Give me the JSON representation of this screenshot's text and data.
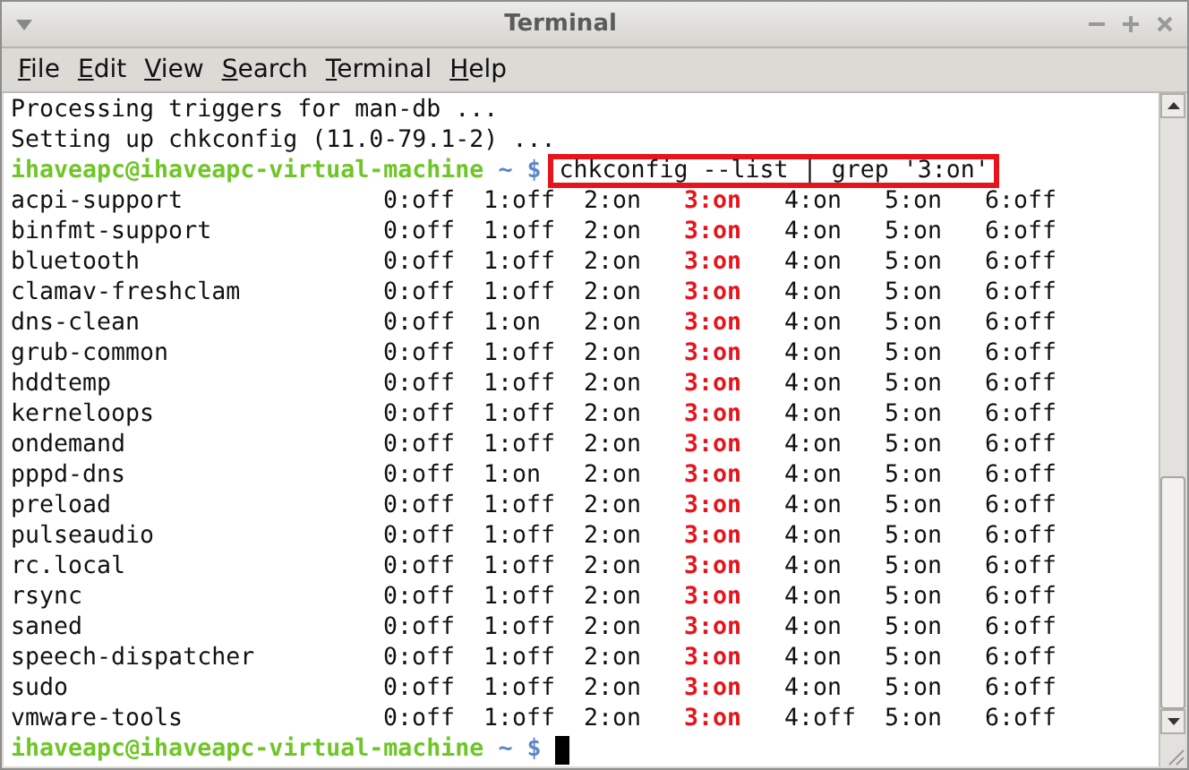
{
  "window": {
    "title": "Terminal"
  },
  "menu": [
    {
      "label": "File",
      "mnemonic_underlined": true
    },
    {
      "label": "Edit",
      "mnemonic_underlined": true
    },
    {
      "label": "View",
      "mnemonic_underlined": true
    },
    {
      "label": "Search",
      "mnemonic_underlined": true
    },
    {
      "label": "Terminal",
      "mnemonic_underlined": true
    },
    {
      "label": "Help",
      "mnemonic_underlined": true
    }
  ],
  "output_lines": [
    "Processing triggers for man-db ...",
    "Setting up chkconfig (11.0-79.1-2) ..."
  ],
  "prompt": {
    "user_host": "ihaveapc@ihaveapc-virtual-machine",
    "path": "~ $",
    "command": "chkconfig --list | grep '3:on'",
    "command_highlighted": true
  },
  "rows": [
    {
      "name": "acpi-support",
      "levels": [
        {
          "text": "0:off",
          "highlighted": false
        },
        {
          "text": "1:off",
          "highlighted": false
        },
        {
          "text": "2:on",
          "highlighted": false
        },
        {
          "text": "3:on",
          "highlighted": true
        },
        {
          "text": "4:on",
          "highlighted": false
        },
        {
          "text": "5:on",
          "highlighted": false
        },
        {
          "text": "6:off",
          "highlighted": false
        }
      ]
    },
    {
      "name": "binfmt-support",
      "levels": [
        {
          "text": "0:off",
          "highlighted": false
        },
        {
          "text": "1:off",
          "highlighted": false
        },
        {
          "text": "2:on",
          "highlighted": false
        },
        {
          "text": "3:on",
          "highlighted": true
        },
        {
          "text": "4:on",
          "highlighted": false
        },
        {
          "text": "5:on",
          "highlighted": false
        },
        {
          "text": "6:off",
          "highlighted": false
        }
      ]
    },
    {
      "name": "bluetooth",
      "levels": [
        {
          "text": "0:off",
          "highlighted": false
        },
        {
          "text": "1:off",
          "highlighted": false
        },
        {
          "text": "2:on",
          "highlighted": false
        },
        {
          "text": "3:on",
          "highlighted": true
        },
        {
          "text": "4:on",
          "highlighted": false
        },
        {
          "text": "5:on",
          "highlighted": false
        },
        {
          "text": "6:off",
          "highlighted": false
        }
      ]
    },
    {
      "name": "clamav-freshclam",
      "levels": [
        {
          "text": "0:off",
          "highlighted": false
        },
        {
          "text": "1:off",
          "highlighted": false
        },
        {
          "text": "2:on",
          "highlighted": false
        },
        {
          "text": "3:on",
          "highlighted": true
        },
        {
          "text": "4:on",
          "highlighted": false
        },
        {
          "text": "5:on",
          "highlighted": false
        },
        {
          "text": "6:off",
          "highlighted": false
        }
      ]
    },
    {
      "name": "dns-clean",
      "levels": [
        {
          "text": "0:off",
          "highlighted": false
        },
        {
          "text": "1:on",
          "highlighted": false
        },
        {
          "text": "2:on",
          "highlighted": false
        },
        {
          "text": "3:on",
          "highlighted": true
        },
        {
          "text": "4:on",
          "highlighted": false
        },
        {
          "text": "5:on",
          "highlighted": false
        },
        {
          "text": "6:off",
          "highlighted": false
        }
      ]
    },
    {
      "name": "grub-common",
      "levels": [
        {
          "text": "0:off",
          "highlighted": false
        },
        {
          "text": "1:off",
          "highlighted": false
        },
        {
          "text": "2:on",
          "highlighted": false
        },
        {
          "text": "3:on",
          "highlighted": true
        },
        {
          "text": "4:on",
          "highlighted": false
        },
        {
          "text": "5:on",
          "highlighted": false
        },
        {
          "text": "6:off",
          "highlighted": false
        }
      ]
    },
    {
      "name": "hddtemp",
      "levels": [
        {
          "text": "0:off",
          "highlighted": false
        },
        {
          "text": "1:off",
          "highlighted": false
        },
        {
          "text": "2:on",
          "highlighted": false
        },
        {
          "text": "3:on",
          "highlighted": true
        },
        {
          "text": "4:on",
          "highlighted": false
        },
        {
          "text": "5:on",
          "highlighted": false
        },
        {
          "text": "6:off",
          "highlighted": false
        }
      ]
    },
    {
      "name": "kerneloops",
      "levels": [
        {
          "text": "0:off",
          "highlighted": false
        },
        {
          "text": "1:off",
          "highlighted": false
        },
        {
          "text": "2:on",
          "highlighted": false
        },
        {
          "text": "3:on",
          "highlighted": true
        },
        {
          "text": "4:on",
          "highlighted": false
        },
        {
          "text": "5:on",
          "highlighted": false
        },
        {
          "text": "6:off",
          "highlighted": false
        }
      ]
    },
    {
      "name": "ondemand",
      "levels": [
        {
          "text": "0:off",
          "highlighted": false
        },
        {
          "text": "1:off",
          "highlighted": false
        },
        {
          "text": "2:on",
          "highlighted": false
        },
        {
          "text": "3:on",
          "highlighted": true
        },
        {
          "text": "4:on",
          "highlighted": false
        },
        {
          "text": "5:on",
          "highlighted": false
        },
        {
          "text": "6:off",
          "highlighted": false
        }
      ]
    },
    {
      "name": "pppd-dns",
      "levels": [
        {
          "text": "0:off",
          "highlighted": false
        },
        {
          "text": "1:on",
          "highlighted": false
        },
        {
          "text": "2:on",
          "highlighted": false
        },
        {
          "text": "3:on",
          "highlighted": true
        },
        {
          "text": "4:on",
          "highlighted": false
        },
        {
          "text": "5:on",
          "highlighted": false
        },
        {
          "text": "6:off",
          "highlighted": false
        }
      ]
    },
    {
      "name": "preload",
      "levels": [
        {
          "text": "0:off",
          "highlighted": false
        },
        {
          "text": "1:off",
          "highlighted": false
        },
        {
          "text": "2:on",
          "highlighted": false
        },
        {
          "text": "3:on",
          "highlighted": true
        },
        {
          "text": "4:on",
          "highlighted": false
        },
        {
          "text": "5:on",
          "highlighted": false
        },
        {
          "text": "6:off",
          "highlighted": false
        }
      ]
    },
    {
      "name": "pulseaudio",
      "levels": [
        {
          "text": "0:off",
          "highlighted": false
        },
        {
          "text": "1:off",
          "highlighted": false
        },
        {
          "text": "2:on",
          "highlighted": false
        },
        {
          "text": "3:on",
          "highlighted": true
        },
        {
          "text": "4:on",
          "highlighted": false
        },
        {
          "text": "5:on",
          "highlighted": false
        },
        {
          "text": "6:off",
          "highlighted": false
        }
      ]
    },
    {
      "name": "rc.local",
      "levels": [
        {
          "text": "0:off",
          "highlighted": false
        },
        {
          "text": "1:off",
          "highlighted": false
        },
        {
          "text": "2:on",
          "highlighted": false
        },
        {
          "text": "3:on",
          "highlighted": true
        },
        {
          "text": "4:on",
          "highlighted": false
        },
        {
          "text": "5:on",
          "highlighted": false
        },
        {
          "text": "6:off",
          "highlighted": false
        }
      ]
    },
    {
      "name": "rsync",
      "levels": [
        {
          "text": "0:off",
          "highlighted": false
        },
        {
          "text": "1:off",
          "highlighted": false
        },
        {
          "text": "2:on",
          "highlighted": false
        },
        {
          "text": "3:on",
          "highlighted": true
        },
        {
          "text": "4:on",
          "highlighted": false
        },
        {
          "text": "5:on",
          "highlighted": false
        },
        {
          "text": "6:off",
          "highlighted": false
        }
      ]
    },
    {
      "name": "saned",
      "levels": [
        {
          "text": "0:off",
          "highlighted": false
        },
        {
          "text": "1:off",
          "highlighted": false
        },
        {
          "text": "2:on",
          "highlighted": false
        },
        {
          "text": "3:on",
          "highlighted": true
        },
        {
          "text": "4:on",
          "highlighted": false
        },
        {
          "text": "5:on",
          "highlighted": false
        },
        {
          "text": "6:off",
          "highlighted": false
        }
      ]
    },
    {
      "name": "speech-dispatcher",
      "levels": [
        {
          "text": "0:off",
          "highlighted": false
        },
        {
          "text": "1:off",
          "highlighted": false
        },
        {
          "text": "2:on",
          "highlighted": false
        },
        {
          "text": "3:on",
          "highlighted": true
        },
        {
          "text": "4:on",
          "highlighted": false
        },
        {
          "text": "5:on",
          "highlighted": false
        },
        {
          "text": "6:off",
          "highlighted": false
        }
      ]
    },
    {
      "name": "sudo",
      "levels": [
        {
          "text": "0:off",
          "highlighted": false
        },
        {
          "text": "1:off",
          "highlighted": false
        },
        {
          "text": "2:on",
          "highlighted": false
        },
        {
          "text": "3:on",
          "highlighted": true
        },
        {
          "text": "4:on",
          "highlighted": false
        },
        {
          "text": "5:on",
          "highlighted": false
        },
        {
          "text": "6:off",
          "highlighted": false
        }
      ]
    },
    {
      "name": "vmware-tools",
      "levels": [
        {
          "text": "0:off",
          "highlighted": false
        },
        {
          "text": "1:off",
          "highlighted": false
        },
        {
          "text": "2:on",
          "highlighted": false
        },
        {
          "text": "3:on",
          "highlighted": true
        },
        {
          "text": "4:off",
          "highlighted": false
        },
        {
          "text": "5:on",
          "highlighted": false
        },
        {
          "text": "6:off",
          "highlighted": false
        }
      ]
    }
  ],
  "final_prompt": {
    "user_host": "ihaveapc@ihaveapc-virtual-machine",
    "path": "~ $"
  }
}
